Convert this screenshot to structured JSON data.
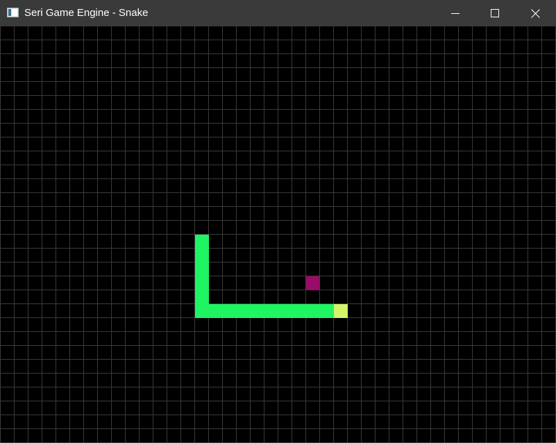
{
  "window": {
    "title": "Seri Game Engine - Snake",
    "controls": {
      "minimize_icon": "minimize-icon",
      "maximize_icon": "maximize-icon",
      "close_icon": "close-icon"
    }
  },
  "game": {
    "grid": {
      "cols": 40,
      "rows": 30,
      "line_color": "#3a3a3a",
      "background": "#000000"
    },
    "snake": {
      "body_color": "#1ff563",
      "head_color": "#d4f56a",
      "head": [
        24,
        20
      ],
      "body": [
        [
          23,
          20
        ],
        [
          22,
          20
        ],
        [
          21,
          20
        ],
        [
          20,
          20
        ],
        [
          19,
          20
        ],
        [
          18,
          20
        ],
        [
          17,
          20
        ],
        [
          16,
          20
        ],
        [
          15,
          20
        ],
        [
          14,
          20
        ],
        [
          14,
          19
        ],
        [
          14,
          18
        ],
        [
          14,
          17
        ],
        [
          14,
          16
        ],
        [
          14,
          15
        ]
      ]
    },
    "food": {
      "color": "#9b0b6a",
      "cell": [
        22,
        18
      ]
    }
  }
}
